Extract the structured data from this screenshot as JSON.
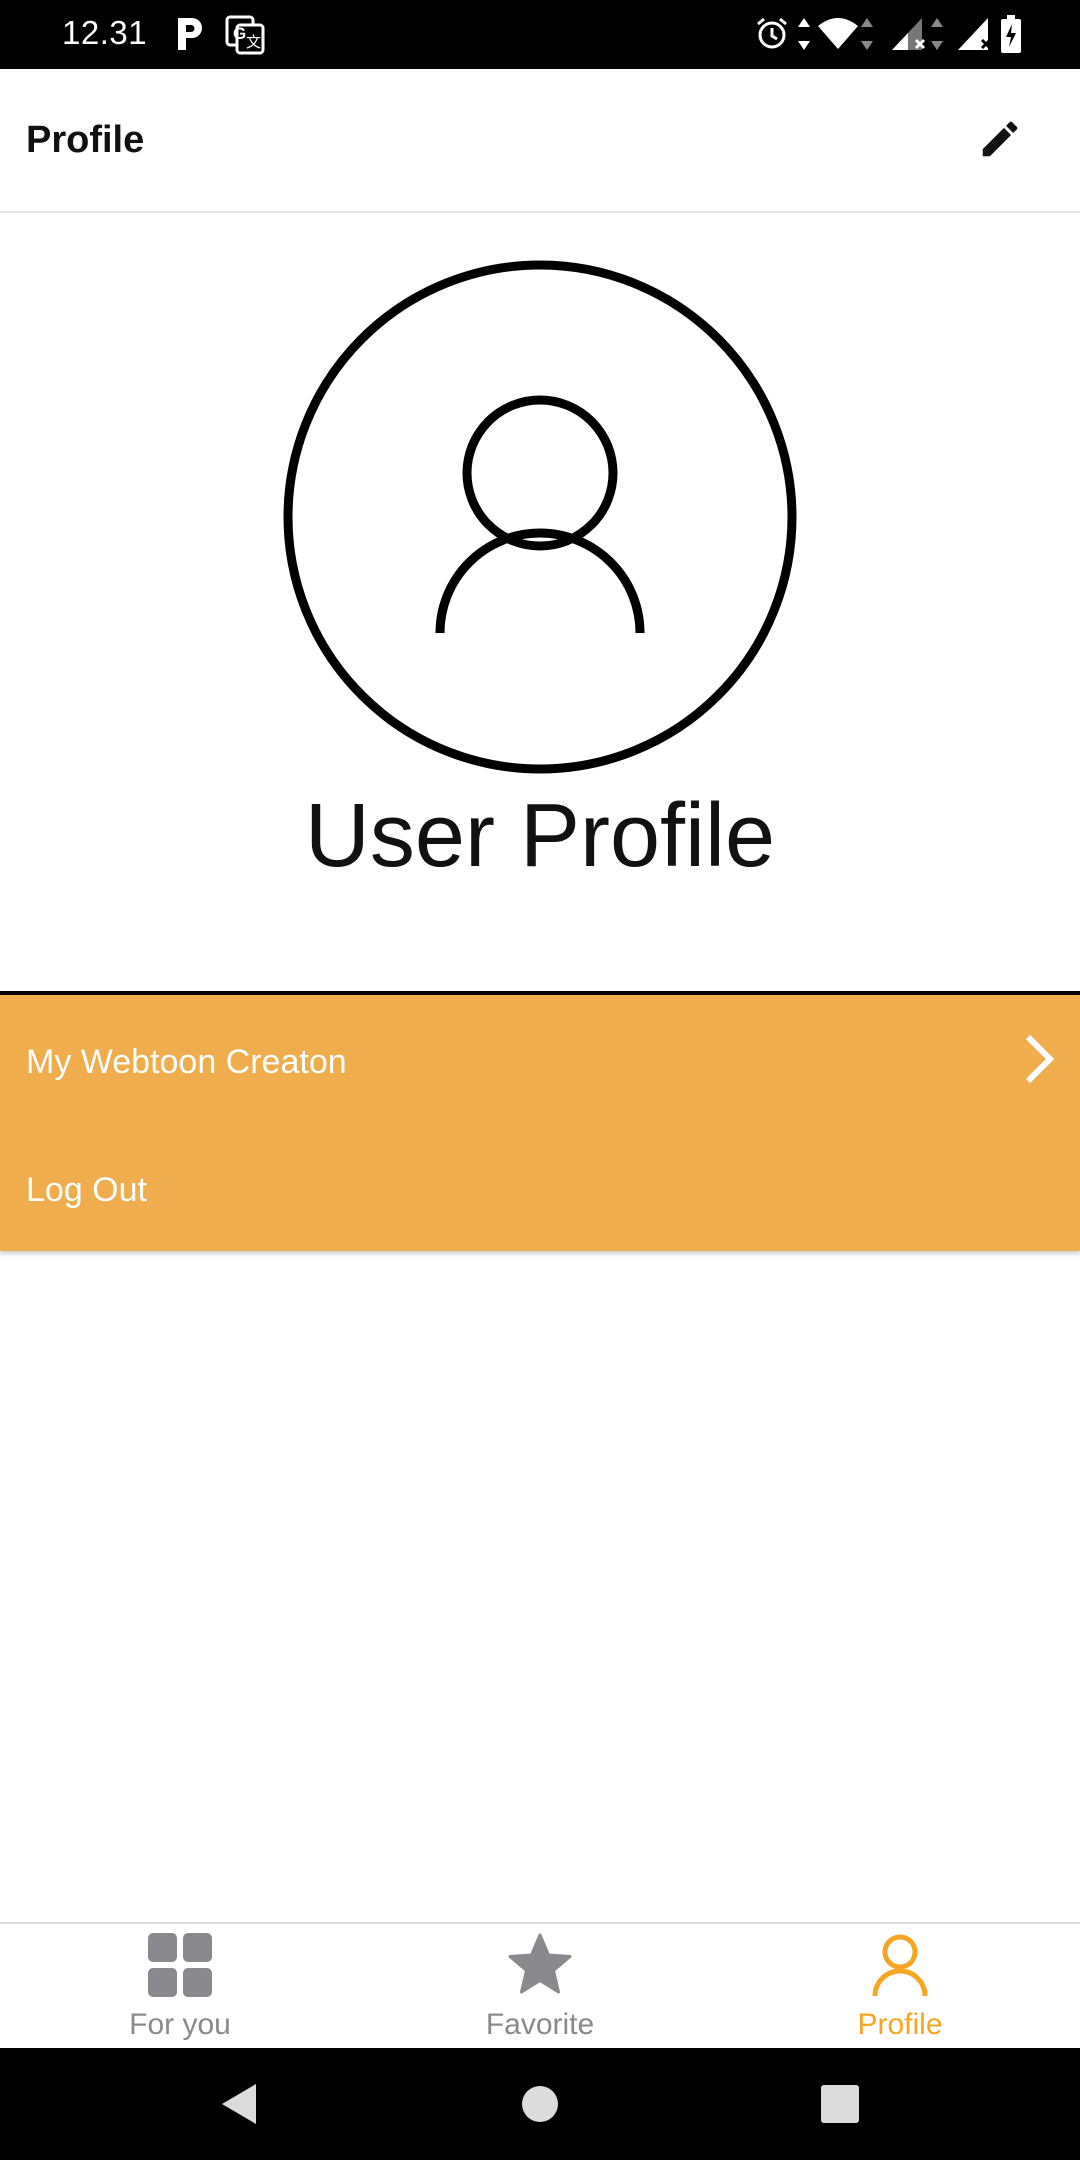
{
  "status_bar": {
    "time": "12.31",
    "icons": [
      "parking-icon",
      "translate-icon",
      "alarm-icon",
      "data-arrows-icon",
      "wifi-icon",
      "signal-1-icon",
      "signal-2-icon",
      "battery-charging-icon"
    ]
  },
  "app_bar": {
    "title": "Profile",
    "edit_icon": "edit-pencil-icon"
  },
  "profile": {
    "avatar_icon": "user-avatar-icon",
    "name": "User Profile"
  },
  "menu": {
    "background": "#EFAD4E",
    "items": [
      {
        "label": "My Webtoon Creaton",
        "has_chevron": true
      },
      {
        "label": "Log Out",
        "has_chevron": false
      }
    ]
  },
  "bottom_nav": {
    "active_color": "#F5A623",
    "inactive_color": "#8A8A8E",
    "items": [
      {
        "label": "For you",
        "icon": "grid-icon",
        "active": false
      },
      {
        "label": "Favorite",
        "icon": "star-icon",
        "active": false
      },
      {
        "label": "Profile",
        "icon": "person-icon",
        "active": true
      }
    ]
  },
  "system_nav": {
    "buttons": [
      "back-icon",
      "home-icon",
      "recents-icon"
    ]
  }
}
